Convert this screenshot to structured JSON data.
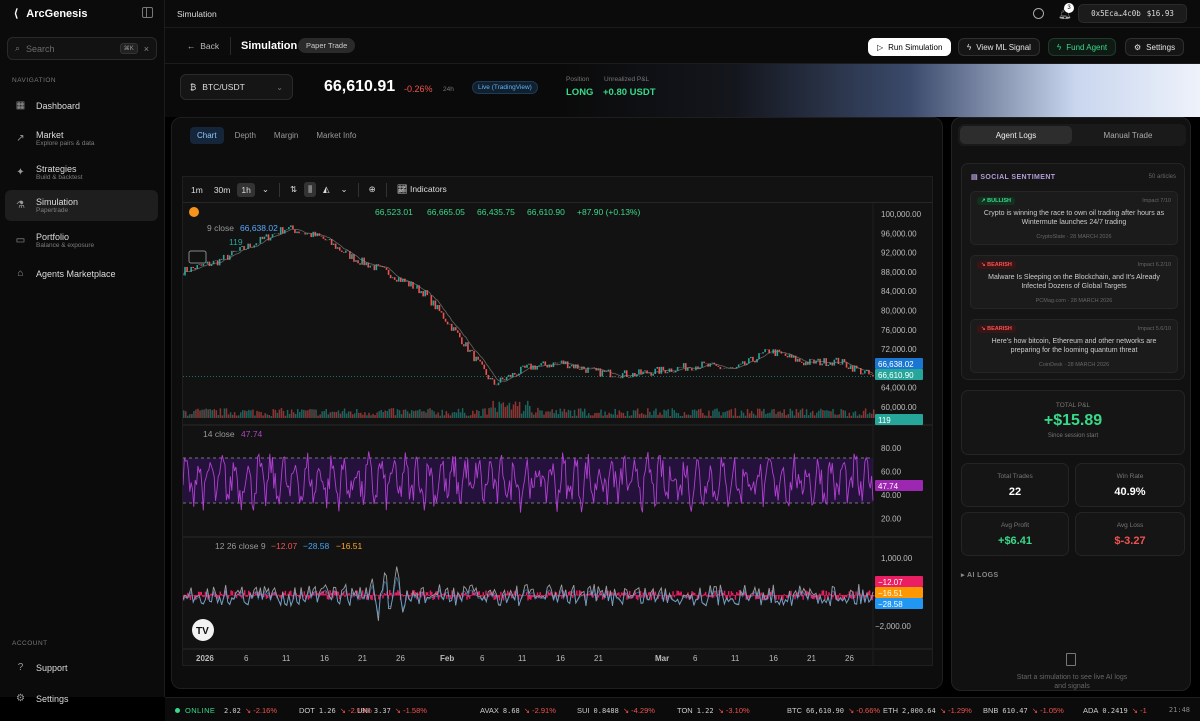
{
  "app": {
    "name": "ArcGenesis",
    "topbar_title": "Simulation",
    "notifications": "3",
    "wallet_address": "0x5Eca…4c0b",
    "wallet_balance": "$16.93"
  },
  "search": {
    "placeholder": "Search",
    "shortcut": "⌘K"
  },
  "sidebar": {
    "nav_heading": "NAVIGATION",
    "items": [
      {
        "label": "Dashboard",
        "sub": "",
        "icon": "grid-icon"
      },
      {
        "label": "Market",
        "sub": "Explore pairs & data",
        "icon": "trend-up-icon"
      },
      {
        "label": "Strategies",
        "sub": "Build & backtest",
        "icon": "sparkle-icon"
      },
      {
        "label": "Simulation",
        "sub": "Papertrade",
        "icon": "flask-icon"
      },
      {
        "label": "Portfolio",
        "sub": "Balance & exposure",
        "icon": "wallet-icon"
      },
      {
        "label": "Agents Marketplace",
        "sub": "",
        "icon": "store-icon"
      }
    ],
    "account_heading": "ACCOUNT",
    "account_items": [
      {
        "label": "Support",
        "icon": "help-icon"
      },
      {
        "label": "Settings",
        "icon": "gear-icon"
      }
    ]
  },
  "header": {
    "back": "Back",
    "title": "Simulation",
    "badge": "Paper Trade",
    "buttons": {
      "run": "Run Simulation",
      "ml": "View ML Signal",
      "fund": "Fund Agent",
      "settings": "Settings"
    }
  },
  "ticker_row": {
    "pair": "BTC/USDT",
    "price": "66,610.91",
    "change": "-0.26%",
    "period": "24h",
    "source": "Live (TradingView)",
    "position_label": "Position",
    "position": "LONG",
    "pnl_label": "Unrealized P&L",
    "pnl": "+0.80 USDT"
  },
  "chart_tabs": [
    "Chart",
    "Depth",
    "Margin",
    "Market Info"
  ],
  "tv": {
    "intervals": [
      "1m",
      "30m",
      "1h"
    ],
    "indicators_label": "Indicators",
    "ohlc": {
      "o": "66,523.01",
      "h": "66,665.05",
      "l": "66,435.75",
      "c": "66,610.90",
      "chg": "+87.90 (+0.13%)"
    },
    "ma_legend": {
      "label": "9 close",
      "value": "66,638.02"
    },
    "vol_value": "119",
    "rsi_legend": {
      "label": "14 close",
      "value": "47.74"
    },
    "macd_legend": {
      "label": "12 26 close 9",
      "v1": "−12.07",
      "v2": "−28.58",
      "v3": "−16.51"
    },
    "price_axis": [
      "100,000.00",
      "96,000.00",
      "92,000.00",
      "88,000.00",
      "84,000.00",
      "80,000.00",
      "76,000.00",
      "72,000.00",
      "68,000.00",
      "64,000.00",
      "60,000.00"
    ],
    "price_tags": {
      "ma": "66,638.02",
      "last": "66,610.90",
      "vol": "119"
    },
    "rsi_axis": [
      "80.00",
      "60.00",
      "40.00",
      "20.00"
    ],
    "rsi_tag": "47.74",
    "macd_axis": [
      "1,000.00",
      "−2,000.00"
    ],
    "macd_tags": [
      "−12.07",
      "−16.51",
      "−28.58"
    ],
    "time_axis": [
      "2026",
      "6",
      "11",
      "16",
      "21",
      "26",
      "Feb",
      "6",
      "11",
      "16",
      "21",
      "Mar",
      "6",
      "11",
      "16",
      "21",
      "26"
    ]
  },
  "chart_data": {
    "type": "line",
    "title": "BTC/USDT 1h",
    "x": [
      "2026-01-01",
      "2026-01-06",
      "2026-01-11",
      "2026-01-14",
      "2026-01-16",
      "2026-01-21",
      "2026-01-26",
      "2026-01-31",
      "2026-02-03",
      "2026-02-06",
      "2026-02-11",
      "2026-02-16",
      "2026-02-21",
      "2026-02-26",
      "2026-03-01",
      "2026-03-06",
      "2026-03-11",
      "2026-03-16",
      "2026-03-21",
      "2026-03-26",
      "2026-03-28"
    ],
    "series": [
      {
        "name": "BTC close",
        "values": [
          88500,
          90500,
          94000,
          97500,
          95500,
          91000,
          88000,
          84000,
          75000,
          65000,
          68500,
          69500,
          67500,
          67000,
          68000,
          69000,
          68000,
          72000,
          69500,
          69800,
          66610
        ]
      }
    ],
    "ylim": [
      58000,
      101000
    ]
  },
  "right": {
    "tabs": [
      "Agent Logs",
      "Manual Trade"
    ],
    "sentiment_title": "SOCIAL SENTIMENT",
    "sentiment_count": "50 articles",
    "news": [
      {
        "tag": "↗ BULLISH",
        "impact": "Impact 7/10",
        "headline": "Crypto is winning the race to own oil trading after hours as Wintermute launches 24/7 trading",
        "source": "CryptoSlate · 28 MARCH 2026"
      },
      {
        "tag": "↘ BEARISH",
        "impact": "Impact 6.2/10",
        "headline": "Malware Is Sleeping on the Blockchain, and It's Already Infected Dozens of Global Targets",
        "source": "PCMag.com · 28 MARCH 2026"
      },
      {
        "tag": "↘ BEARISH",
        "impact": "Impact 5.6/10",
        "headline": "Here's how bitcoin, Ethereum and other networks are preparing for the looming quantum threat",
        "source": "CoinDesk · 28 MARCH 2026"
      }
    ],
    "pnl_label": "TOTAL P&L",
    "pnl_value": "+$15.89",
    "pnl_sub": "Since session start",
    "stats": [
      {
        "label": "Total Trades",
        "value": "22"
      },
      {
        "label": "Win Rate",
        "value": "40.9%"
      },
      {
        "label": "Avg Profit",
        "value": "+$6.41"
      },
      {
        "label": "Avg Loss",
        "value": "$-3.27"
      }
    ],
    "ai_logs": "AI LOGS",
    "ai_logs_msg": "Start a simulation to see live AI logs and signals"
  },
  "ticker": {
    "status": "ONLINE",
    "items": [
      {
        "sym": "",
        "price": "2.02",
        "chg": "↘ -2.16%"
      },
      {
        "sym": "DOT",
        "price": "1.26",
        "chg": "↘ -2.18%"
      },
      {
        "sym": "UNI",
        "price": "3.37",
        "chg": "↘ -1.58%"
      },
      {
        "sym": "AVAX",
        "price": "8.68",
        "chg": "↘ -2.91%"
      },
      {
        "sym": "SUI",
        "price": "0.8488",
        "chg": "↘ -4.29%"
      },
      {
        "sym": "TON",
        "price": "1.22",
        "chg": "↘ -3.10%"
      },
      {
        "sym": "BTC",
        "price": "66,610.90",
        "chg": "↘ -0.66%"
      },
      {
        "sym": "ETH",
        "price": "2,000.64",
        "chg": "↘ -1.29%"
      },
      {
        "sym": "BNB",
        "price": "610.47",
        "chg": "↘ -1.05%"
      },
      {
        "sym": "ADA",
        "price": "0.2419",
        "chg": "↘ -1"
      }
    ],
    "clock": "21:48"
  },
  "colors": {
    "up": "#39d98a",
    "down": "#ef5350",
    "accent": "#8fc6ff",
    "rsi": "#9c27b0",
    "macd_hist": "#e91e63",
    "ma": "#2196f3"
  }
}
